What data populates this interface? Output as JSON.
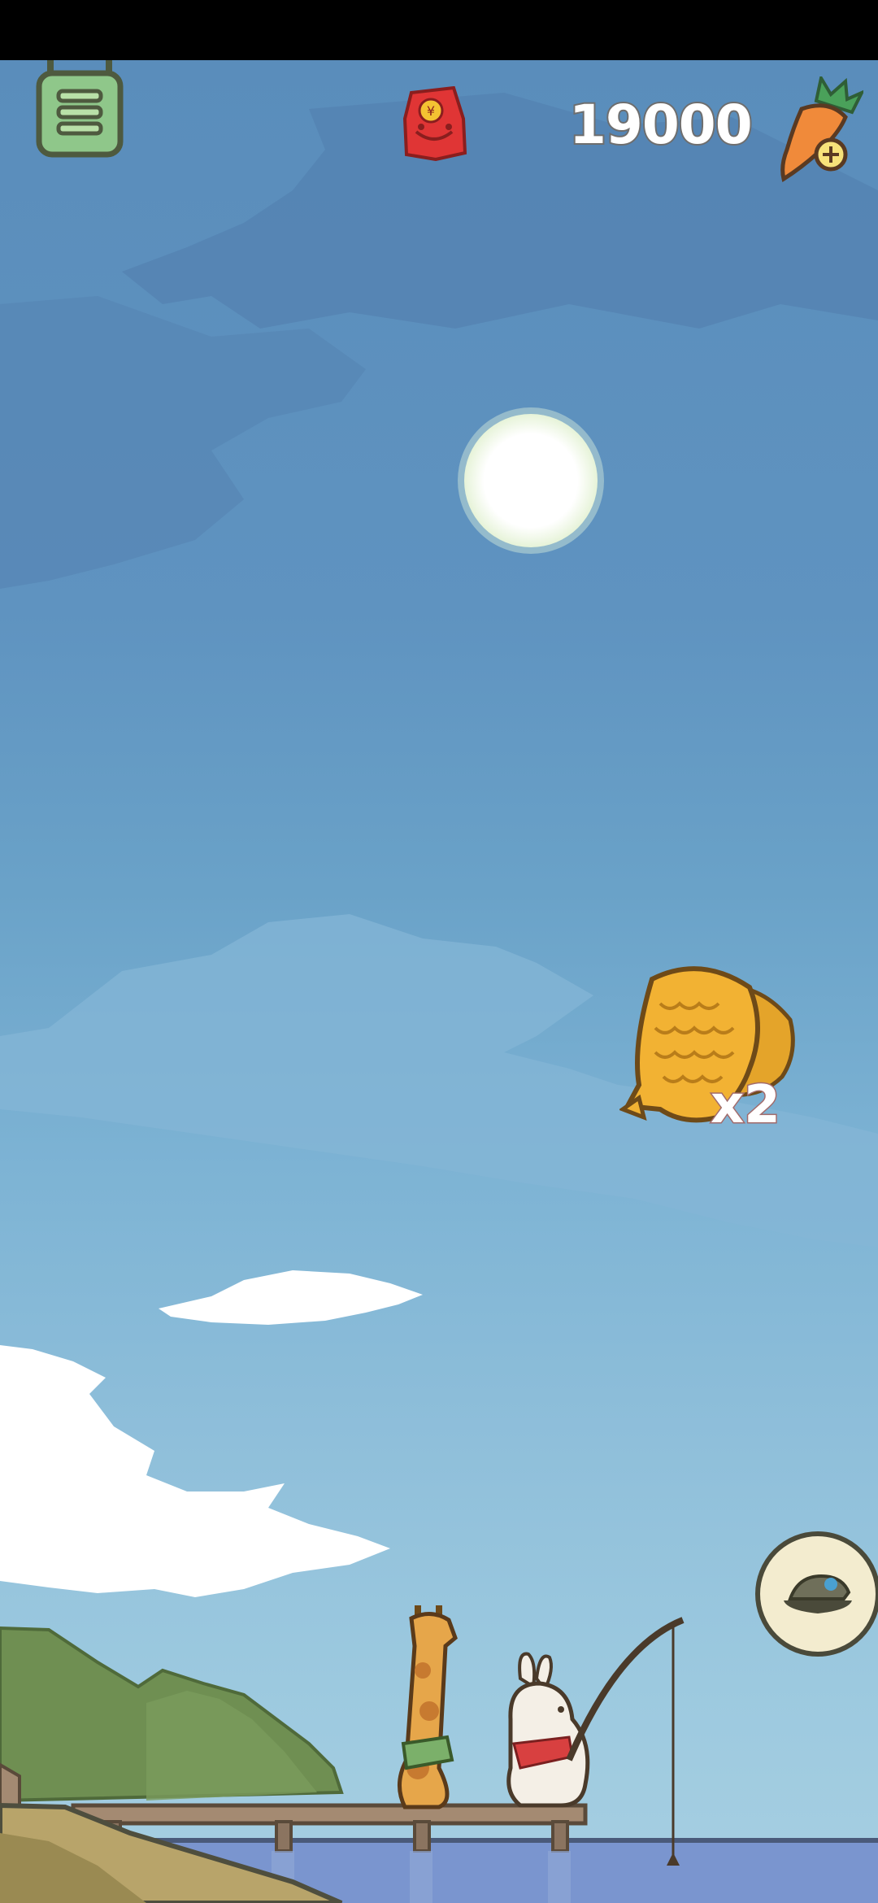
{
  "hud": {
    "carrot_count": "19000",
    "menu_icon": "menu-list-icon",
    "moneybag_icon": "red-moneybag-icon",
    "carrot_icon": "carrot-add-icon"
  },
  "catch": {
    "item_icon": "taiyaki-fish-icon",
    "quantity": "x2"
  },
  "bait_button": {
    "icon": "bait-bowl-icon"
  },
  "colors": {
    "sky_top": "#5a8dbb",
    "sky_bottom": "#a7cfe2",
    "moon": "#ffffff",
    "taiyaki": "#f2b233",
    "water": "#7a95cf",
    "hill": "#6f8f52"
  }
}
